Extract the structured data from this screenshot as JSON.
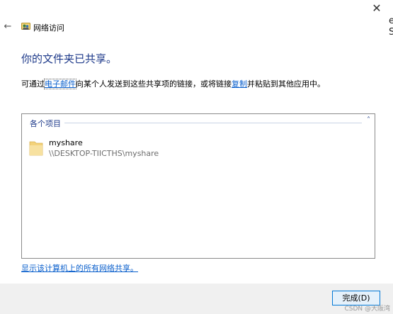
{
  "window": {
    "title": "网络访问",
    "close_glyph": "✕",
    "back_glyph": "←",
    "edge_letters": "e\nS"
  },
  "main": {
    "heading": "你的文件夹已共享。",
    "desc_prefix": "可通过",
    "email_link": "电子邮件",
    "desc_middle": "向某个人发送到这些共享项的链接，或将链接",
    "copy_link": "复制",
    "desc_suffix": "并粘贴到其他应用中。"
  },
  "list": {
    "group_label": "各个项目",
    "chevron_glyph": "˄",
    "items": [
      {
        "name": "myshare",
        "path": "\\\\DESKTOP-TIICTHS\\myshare"
      }
    ]
  },
  "footer": {
    "show_all_link": "显示该计算机上的所有网络共享。",
    "finish_label": "完成(D)"
  },
  "watermark": "CSDN @大阪湾",
  "colors": {
    "heading": "#1e3a8a",
    "link": "#0a5fcc",
    "button_border": "#0078d7"
  },
  "icons": {
    "back": "back-arrow-icon",
    "app": "network-sharing-icon",
    "folder": "folder-icon",
    "close": "close-icon"
  }
}
